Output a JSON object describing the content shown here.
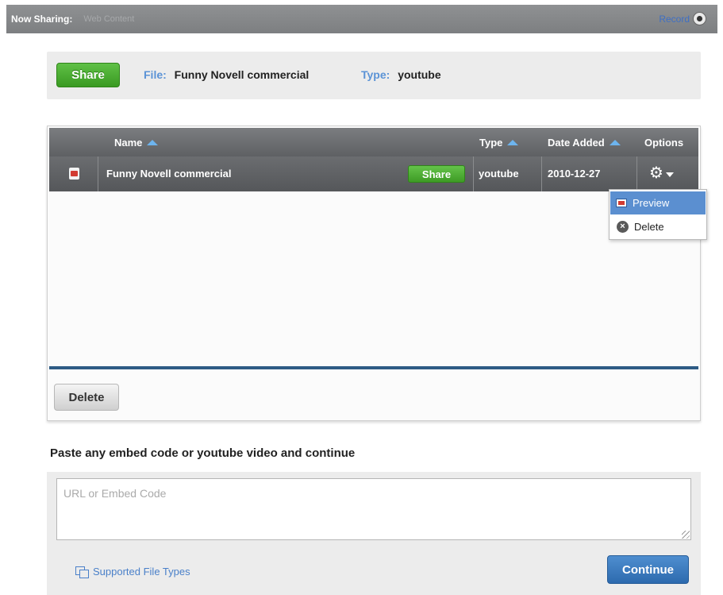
{
  "topbar": {
    "now_sharing_label": "Now Sharing:",
    "now_sharing_value": "Web Content",
    "record_label": "Record"
  },
  "share_panel": {
    "share_button": "Share",
    "file_label": "File:",
    "file_value": "Funny Novell commercial",
    "type_label": "Type:",
    "type_value": "youtube"
  },
  "table": {
    "columns": {
      "name": "Name",
      "type": "Type",
      "date_added": "Date Added",
      "options": "Options"
    },
    "rows": [
      {
        "icon": "youtube-icon",
        "name": "Funny Novell commercial",
        "share_label": "Share",
        "type": "youtube",
        "date_added": "2010-12-27"
      }
    ],
    "delete_button": "Delete"
  },
  "options_menu": {
    "items": [
      {
        "label": "Preview",
        "icon": "preview-icon",
        "highlighted": true
      },
      {
        "label": "Delete",
        "icon": "delete-circle-icon",
        "highlighted": false
      }
    ]
  },
  "embed": {
    "heading": "Paste any embed code or youtube video and continue",
    "placeholder": "URL or Embed Code",
    "supported_link": "Supported File Types",
    "continue_button": "Continue"
  },
  "colors": {
    "green_button": "#3a9a22",
    "blue_button": "#2d6aae",
    "link_blue": "#4a80c9",
    "header_gray": "#7d7f81",
    "menu_highlight": "#5b8fd0"
  }
}
